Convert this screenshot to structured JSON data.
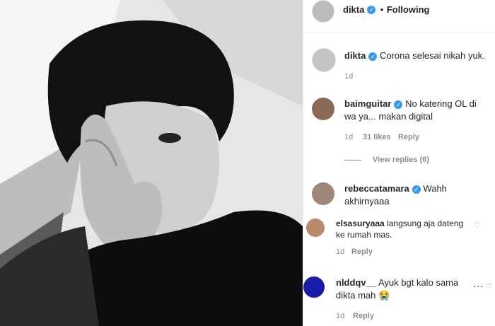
{
  "post": {
    "author": "dikta",
    "follow_status": "Following",
    "separator": "•"
  },
  "caption": {
    "author": "dikta",
    "text": "Corona selesai nikah yuk.",
    "time": "1d"
  },
  "comments": [
    {
      "author": "baimguitar",
      "verified": true,
      "text": "No katering OL di wa ya... makan digital",
      "time": "1d",
      "likes": "31 likes",
      "reply": "Reply",
      "view_replies": "View replies (6)"
    },
    {
      "author": "rebeccatamara",
      "verified": true,
      "text": "Wahh akhirnyaaa"
    },
    {
      "author": "elsasuryaaa",
      "text": "langsung aja dateng ke rumah mas.",
      "time": "1d",
      "reply": "Reply"
    },
    {
      "author": "nlddqv__",
      "text": "Ayuk bgt kalo sama dikta mah 😭",
      "time": "1d",
      "reply": "Reply"
    }
  ],
  "colors": {
    "verified": "#3897f0",
    "muted": "#8e8e8e",
    "text": "#262626"
  },
  "icons": [
    "verified-badge-icon",
    "heart-icon",
    "more-options-icon"
  ]
}
